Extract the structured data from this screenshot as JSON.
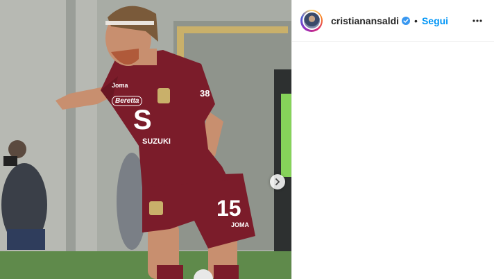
{
  "post": {
    "username": "cristianansaldi",
    "follow_label": "Segui",
    "separator": "•",
    "jersey": {
      "sponsor_top": "Joma",
      "sponsor_main": "Beretta",
      "sponsor_chest": "SUZUKI",
      "sleeve_number": "38",
      "shorts_number": "15",
      "shorts_brand": "JOMA"
    }
  },
  "icons": {
    "verified": "verified-badge-icon",
    "more": "more-options-icon",
    "next": "chevron-right-icon"
  },
  "colors": {
    "follow": "#0095f6",
    "verified": "#3897f0",
    "jersey": "#7b1c2a"
  }
}
